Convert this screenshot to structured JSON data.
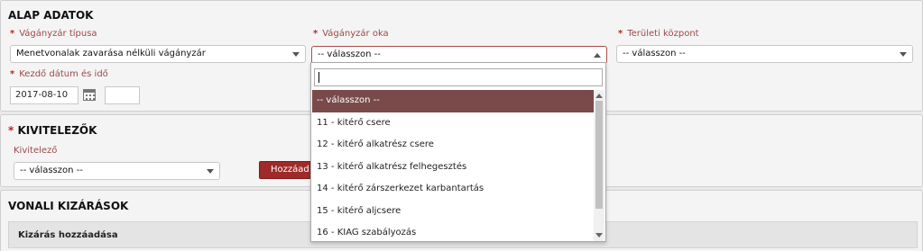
{
  "alap": {
    "title": "ALAP ADATOK",
    "vaganyzar_tipusa": {
      "label": "Vágányzár típusa",
      "value": "Menetvonalak zavarása nélküli vágányzár"
    },
    "vaganyzar_oka": {
      "label": "Vágányzár oka",
      "value": "-- válasszon --"
    },
    "teruleti_kozpont": {
      "label": "Területi központ",
      "value": "-- válasszon --"
    },
    "kezdo_datum": {
      "label": "Kezdő dátum és idő",
      "date": "2017-08-10",
      "time": ""
    }
  },
  "kivitelezok": {
    "title": "KIVITELEZŐK",
    "kivitelezo_label": "Kivitelező",
    "kivitelezo_value": "-- válasszon --",
    "add_button": "Hozzáad"
  },
  "vonali": {
    "title": "VONALI KIZÁRÁSOK",
    "kizaras_hozzaadasa": "Kizárás hozzáadása"
  },
  "dropdown": {
    "search_value": "",
    "options": [
      "-- válasszon --",
      "11 - kitérő csere",
      "12 - kitérő alkatrész csere",
      "13 - kitérő alkatrész felhegesztés",
      "14 - kitérő zárszerkezet karbantartás",
      "15 - kitérő aljcsere",
      "16 - KIAG szabályozás"
    ]
  },
  "required_marker": "*",
  "colors": {
    "accent": "#9e2a2a",
    "selected": "#7a4a4a",
    "label": "#9b4a4a"
  }
}
